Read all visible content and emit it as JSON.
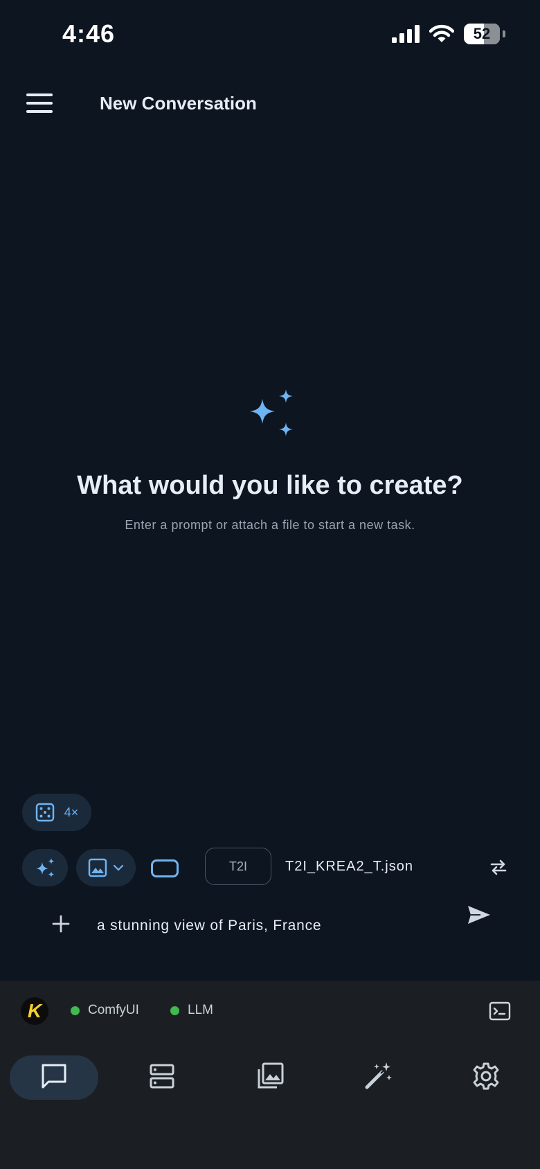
{
  "status_bar": {
    "time": "4:46",
    "battery": "52"
  },
  "header": {
    "title": "New Conversation"
  },
  "hero": {
    "title": "What would you like to create?",
    "subtitle": "Enter a prompt or attach a file to start a new task."
  },
  "toolbar": {
    "batch_label": "4×",
    "mode_label": "T2I",
    "workflow": "T2I_KREA2_T.json"
  },
  "prompt": {
    "value": "a stunning view of Paris, France"
  },
  "services": [
    {
      "name": "ComfyUI",
      "status_color": "#3fb950"
    },
    {
      "name": "LLM",
      "status_color": "#3fb950"
    }
  ],
  "avatar_letter": "K",
  "colors": {
    "accent": "#6fb4f2",
    "background": "#0d1520",
    "bottom_bar": "#1b1f23"
  }
}
